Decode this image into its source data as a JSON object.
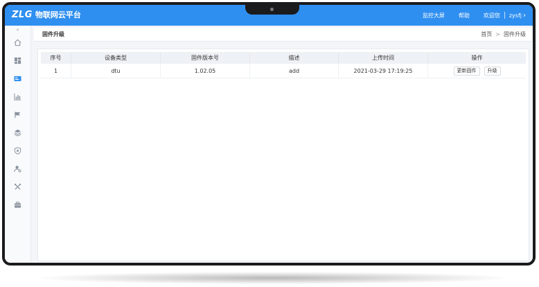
{
  "app": {
    "logo_mark": "ZLG",
    "logo_text": "物联网云平台"
  },
  "nav": {
    "monitor": "监控大屏",
    "help": "帮助",
    "welcome": "欢迎您",
    "user": "zysfj",
    "chevron": "›"
  },
  "sidebar": {
    "collapse": "«",
    "icons": [
      "home-icon",
      "dashboard-icon",
      "device-card-icon",
      "chart-icon",
      "flag-icon",
      "layers-icon",
      "shield-icon",
      "user-gear-icon",
      "tools-icon",
      "briefcase-icon"
    ]
  },
  "page": {
    "title": "固件升级",
    "breadcrumb": [
      "首页",
      "固件升级"
    ],
    "breadcrumb_sep": ">"
  },
  "table": {
    "headers": [
      "序号",
      "设备类型",
      "固件版本号",
      "描述",
      "上传时间",
      "操作"
    ],
    "rows": [
      {
        "index": "1",
        "device_type": "dtu",
        "version": "1.02.05",
        "description": "add",
        "uploaded": "2021-03-29 17:19:25"
      }
    ],
    "actions": {
      "update": "更新固件",
      "upgrade": "升级"
    }
  },
  "colors": {
    "topbar": "#2f8ff0",
    "bezel": "#1b1b1d",
    "header_bg": "#eef1f5"
  }
}
